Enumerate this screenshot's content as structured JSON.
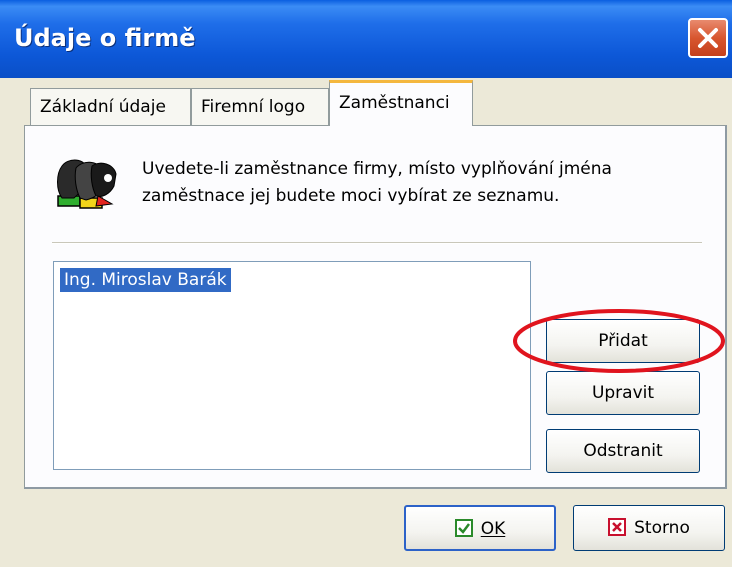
{
  "window": {
    "title": "Údaje o firmě"
  },
  "tabs": [
    {
      "label": "Základní údaje"
    },
    {
      "label": "Firemní logo"
    },
    {
      "label": "Zaměstnanci"
    }
  ],
  "active_tab": "Zaměstnanci",
  "info": {
    "line1": "Uvedete-li zaměstnance firmy, místo vyplňování jména",
    "line2": "zaměstnace jej budete moci vybírat ze seznamu."
  },
  "employees": {
    "items": [
      "Ing. Miroslav Barák"
    ],
    "selected": "Ing. Miroslav Barák"
  },
  "buttons": {
    "add": "Přidat",
    "edit": "Upravit",
    "remove": "Odstranit",
    "ok": "OK",
    "cancel": "Storno"
  },
  "colors": {
    "title_bar": "#0a5fe0",
    "selection": "#316ac5",
    "highlight_ellipse": "#e0141e",
    "ok_icon": "#2a8a2a",
    "cancel_icon": "#c8102e"
  },
  "icons": {
    "close": "close-icon",
    "people": "people-icon",
    "ok": "checkmark-icon",
    "cancel": "x-box-icon"
  }
}
